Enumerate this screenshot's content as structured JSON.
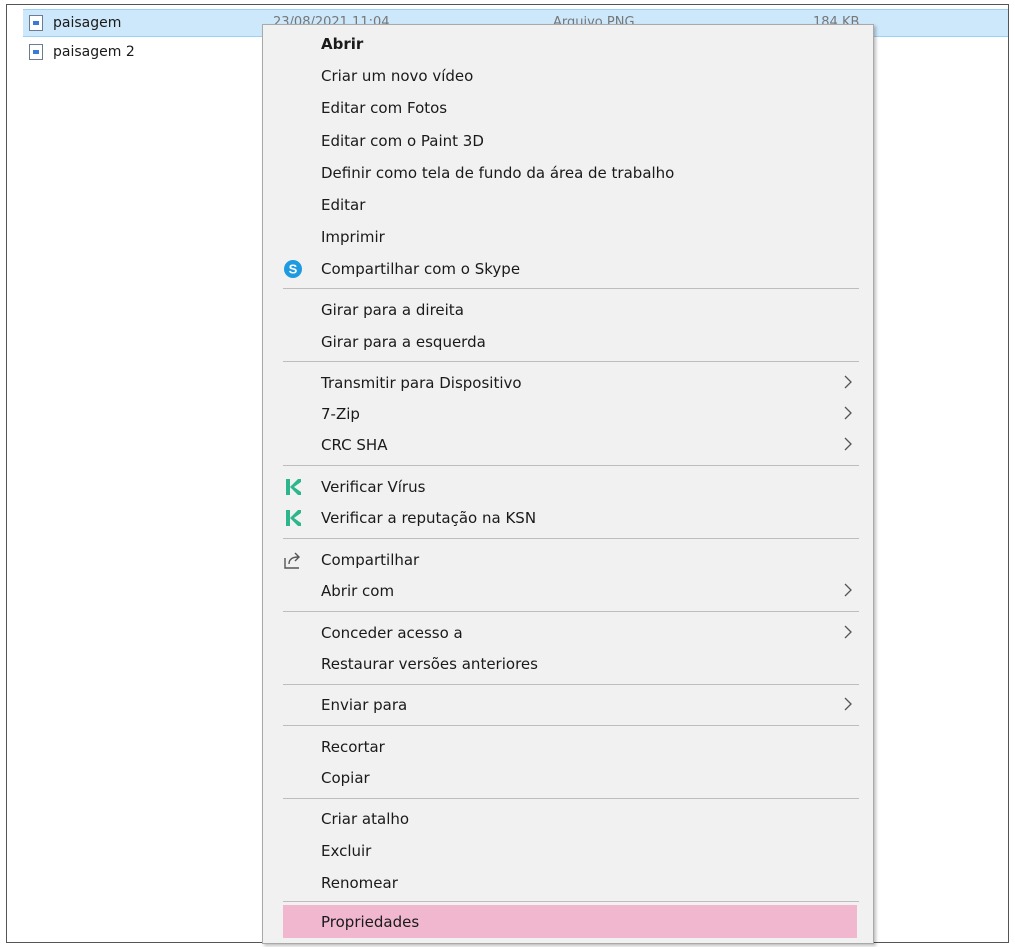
{
  "files": [
    {
      "name": "paisagem",
      "date": "23/08/2021 11:04",
      "type": "Arquivo PNG",
      "size": "184 KB"
    },
    {
      "name": "paisagem 2"
    }
  ],
  "menu": {
    "items": [
      {
        "label": "Abrir"
      },
      {
        "label": "Criar um novo vídeo"
      },
      {
        "label": "Editar com Fotos"
      },
      {
        "label": "Editar com o Paint 3D"
      },
      {
        "label": "Definir como tela de fundo da área de trabalho"
      },
      {
        "label": "Editar"
      },
      {
        "label": "Imprimir"
      },
      {
        "label": "Compartilhar com o Skype",
        "icon": "skype-icon"
      },
      {
        "label": "Girar para a direita"
      },
      {
        "label": "Girar para a esquerda"
      },
      {
        "label": "Transmitir para Dispositivo",
        "submenu": true
      },
      {
        "label": "7-Zip",
        "submenu": true
      },
      {
        "label": "CRC SHA",
        "submenu": true
      },
      {
        "label": "Verificar Vírus",
        "icon": "kaspersky-icon"
      },
      {
        "label": "Verificar a reputação na KSN",
        "icon": "kaspersky-icon"
      },
      {
        "label": "Compartilhar",
        "icon": "share-icon"
      },
      {
        "label": "Abrir com",
        "submenu": true
      },
      {
        "label": "Conceder acesso a",
        "submenu": true
      },
      {
        "label": "Restaurar versões anteriores"
      },
      {
        "label": "Enviar para",
        "submenu": true
      },
      {
        "label": "Recortar"
      },
      {
        "label": "Copiar"
      },
      {
        "label": "Criar atalho"
      },
      {
        "label": "Excluir"
      },
      {
        "label": "Renomear"
      },
      {
        "label": "Propriedades",
        "highlighted": true
      }
    ]
  },
  "colors": {
    "highlight": "#f0b7cf",
    "selection": "#cde8fb",
    "skype": "#1e9be0",
    "kaspersky": "#2fb58b"
  }
}
